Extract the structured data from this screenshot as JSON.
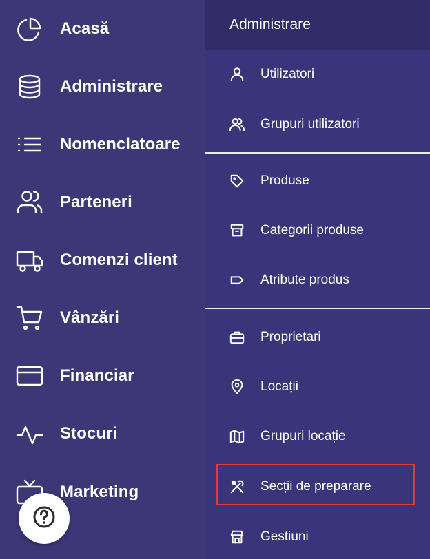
{
  "sidebar": {
    "items": [
      {
        "label": "Acasă",
        "icon": "pie-chart-icon"
      },
      {
        "label": "Administrare",
        "icon": "database-icon"
      },
      {
        "label": "Nomenclatoare",
        "icon": "list-icon"
      },
      {
        "label": "Parteneri",
        "icon": "users-icon"
      },
      {
        "label": "Comenzi client",
        "icon": "truck-icon"
      },
      {
        "label": "Vânzări",
        "icon": "cart-icon"
      },
      {
        "label": "Financiar",
        "icon": "credit-card-icon"
      },
      {
        "label": "Stocuri",
        "icon": "activity-icon"
      },
      {
        "label": "Marketing",
        "icon": "tv-icon"
      }
    ]
  },
  "submenu": {
    "title": "Administrare",
    "items": [
      {
        "label": "Utilizatori",
        "icon": "user-icon"
      },
      {
        "label": "Grupuri utilizatori",
        "icon": "users-icon"
      },
      {
        "label": "Produse",
        "icon": "tag-icon"
      },
      {
        "label": "Categorii produse",
        "icon": "archive-icon"
      },
      {
        "label": "Atribute produs",
        "icon": "label-icon"
      },
      {
        "label": "Proprietari",
        "icon": "briefcase-icon"
      },
      {
        "label": "Locații",
        "icon": "map-pin-icon"
      },
      {
        "label": "Grupuri locație",
        "icon": "map-icon"
      },
      {
        "label": "Secții de preparare",
        "icon": "utensils-icon"
      },
      {
        "label": "Gestiuni",
        "icon": "store-icon"
      }
    ]
  },
  "help": {
    "icon": "help-circle-icon"
  },
  "colors": {
    "sidebar_bg": "#3d3677",
    "submenu_bg": "#3a347b",
    "submenu_header_bg": "#322c68",
    "highlight": "#e0393e",
    "text": "#ffffff"
  }
}
